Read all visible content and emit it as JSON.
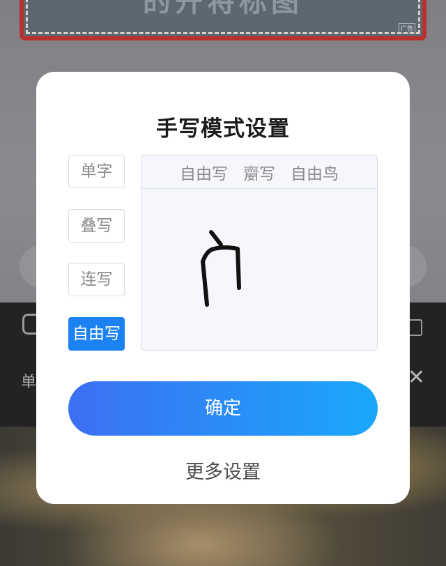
{
  "background": {
    "banner_text": "的开将标图",
    "ad_tag": "广告",
    "side_text": "单",
    "close_glyph": "✕"
  },
  "dialog": {
    "title": "手写模式设置",
    "modes": [
      {
        "label": "单字",
        "selected": false
      },
      {
        "label": "叠写",
        "selected": false
      },
      {
        "label": "连写",
        "selected": false
      },
      {
        "label": "自由写",
        "selected": true
      }
    ],
    "candidates": [
      "自由写",
      "䶒写",
      "自由鸟"
    ],
    "confirm_label": "确定",
    "more_settings_label": "更多设置"
  },
  "colors": {
    "accent": "#1c82f3",
    "confirm_gradient_start": "#3d6ff3",
    "confirm_gradient_end": "#19a8fb"
  }
}
